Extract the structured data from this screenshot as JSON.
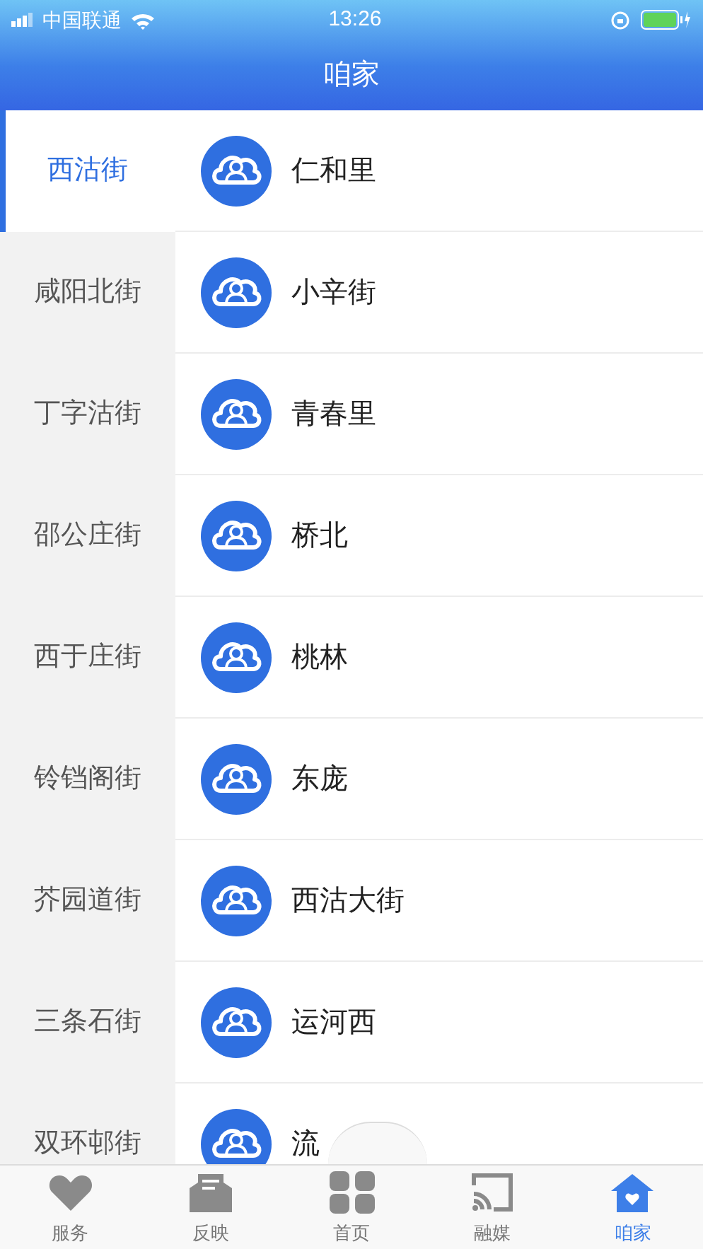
{
  "status_bar": {
    "carrier": "中国联通",
    "time": "13:26"
  },
  "header": {
    "title": "咱家"
  },
  "streets": [
    {
      "label": "西沽街",
      "selected": true
    },
    {
      "label": "咸阳北街",
      "selected": false
    },
    {
      "label": "丁字沽街",
      "selected": false
    },
    {
      "label": "邵公庄街",
      "selected": false
    },
    {
      "label": "西于庄街",
      "selected": false
    },
    {
      "label": "铃铛阁街",
      "selected": false
    },
    {
      "label": "芥园道街",
      "selected": false
    },
    {
      "label": "三条石街",
      "selected": false
    },
    {
      "label": "双环邨街",
      "selected": false
    }
  ],
  "communities": [
    "仁和里",
    "小辛街",
    "青春里",
    "桥北",
    "桃林",
    "东庞",
    "西沽大街",
    "运河西",
    "流"
  ],
  "tab_bar": [
    {
      "label": "服务",
      "selected": false
    },
    {
      "label": "反映",
      "selected": false
    },
    {
      "label": "首页",
      "selected": false
    },
    {
      "label": "融媒",
      "selected": false
    },
    {
      "label": "咱家",
      "selected": true
    }
  ]
}
